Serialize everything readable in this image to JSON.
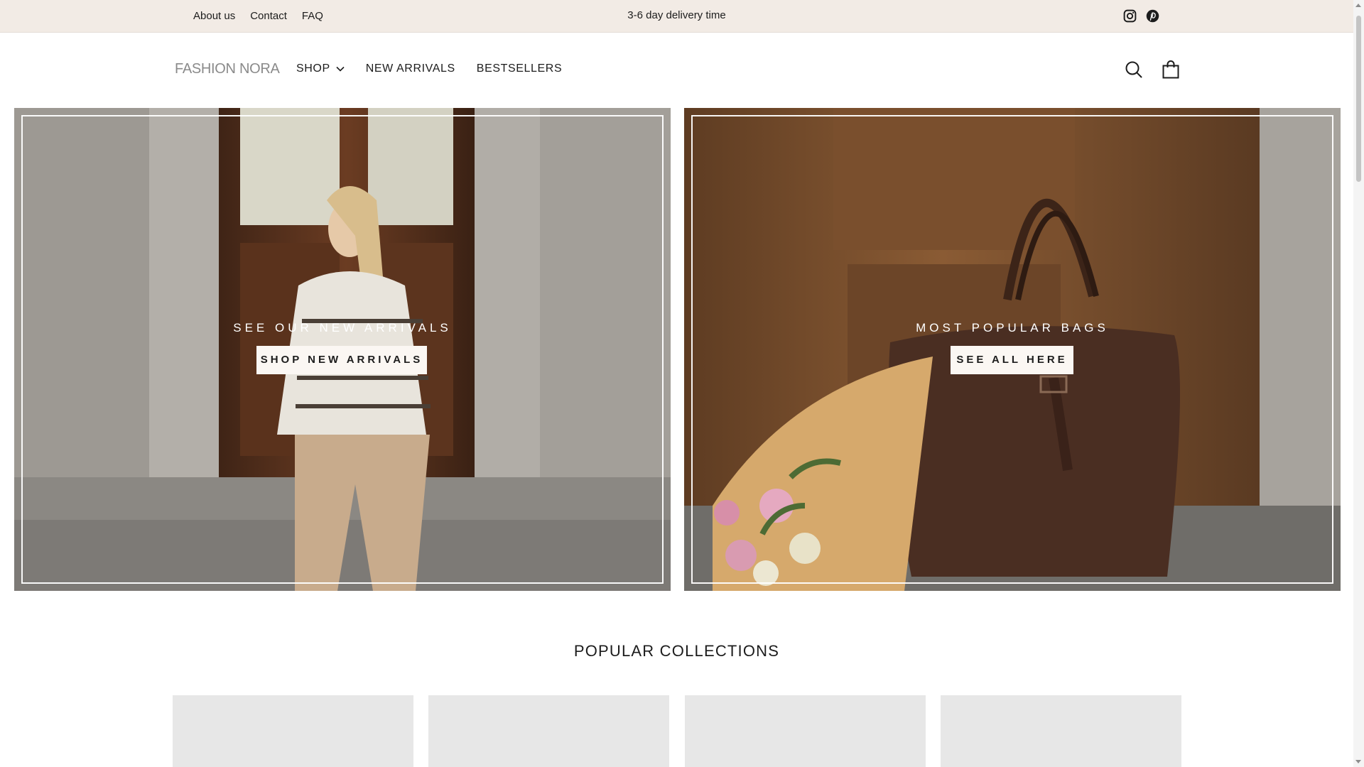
{
  "announcement": {
    "links": [
      "About us",
      "Contact",
      "FAQ"
    ],
    "message": "3-6 day delivery time",
    "social_icons": [
      "instagram-icon",
      "pinterest-icon"
    ]
  },
  "header": {
    "logo": "FASHION NORA",
    "nav": [
      "SHOP",
      "NEW ARRIVALS",
      "BESTSELLERS"
    ],
    "icons": [
      "search-icon",
      "shopping-bag-icon"
    ]
  },
  "hero": {
    "left": {
      "caption": "SEE OUR NEW ARRIVALS",
      "button": "SHOP NEW ARRIVALS"
    },
    "right": {
      "caption": "MOST POPULAR BAGS",
      "button": "SEE ALL HERE"
    }
  },
  "collections": {
    "title": "POPULAR COLLECTIONS",
    "card_count_visible": 4
  },
  "colors": {
    "announcement_bg": "#f2ebe5",
    "button_bg": "#fbf7f3",
    "card_placeholder": "#e7e7e7",
    "text": "#1c1c1c"
  }
}
